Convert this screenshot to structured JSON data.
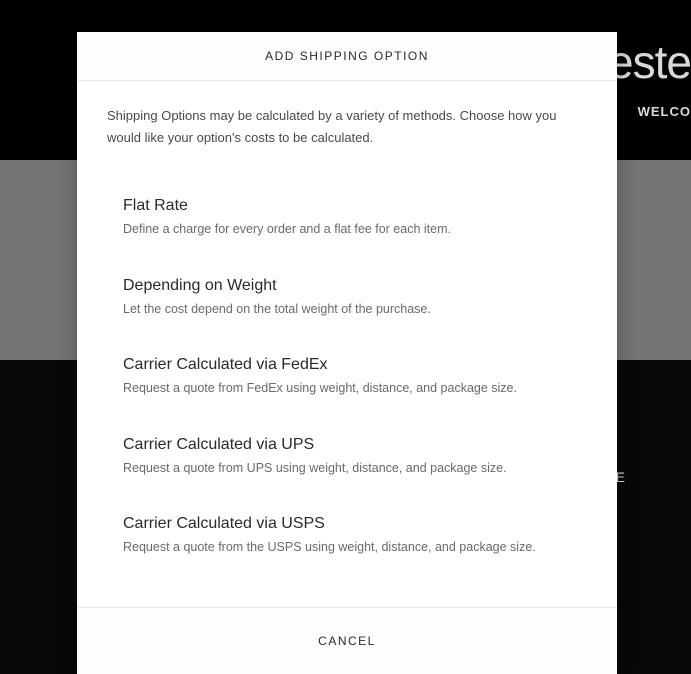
{
  "background": {
    "brand_partial": "este",
    "welcome_partial": "WELCO",
    "side_letter": "E"
  },
  "modal": {
    "title": "ADD SHIPPING OPTION",
    "intro": "Shipping Options may be calculated by a variety of methods. Choose how you would like your option's costs to be calculated.",
    "options": [
      {
        "title": "Flat Rate",
        "desc": "Define a charge for every order and a flat fee for each item."
      },
      {
        "title": "Depending on Weight",
        "desc": "Let the cost depend on the total weight of the purchase."
      },
      {
        "title": "Carrier Calculated via FedEx",
        "desc": "Request a quote from FedEx using weight, distance, and package size."
      },
      {
        "title": "Carrier Calculated via UPS",
        "desc": "Request a quote from UPS using weight, distance, and package size."
      },
      {
        "title": "Carrier Calculated via USPS",
        "desc": "Request a quote from the USPS using weight, distance, and package size."
      }
    ],
    "cancel_label": "CANCEL"
  }
}
